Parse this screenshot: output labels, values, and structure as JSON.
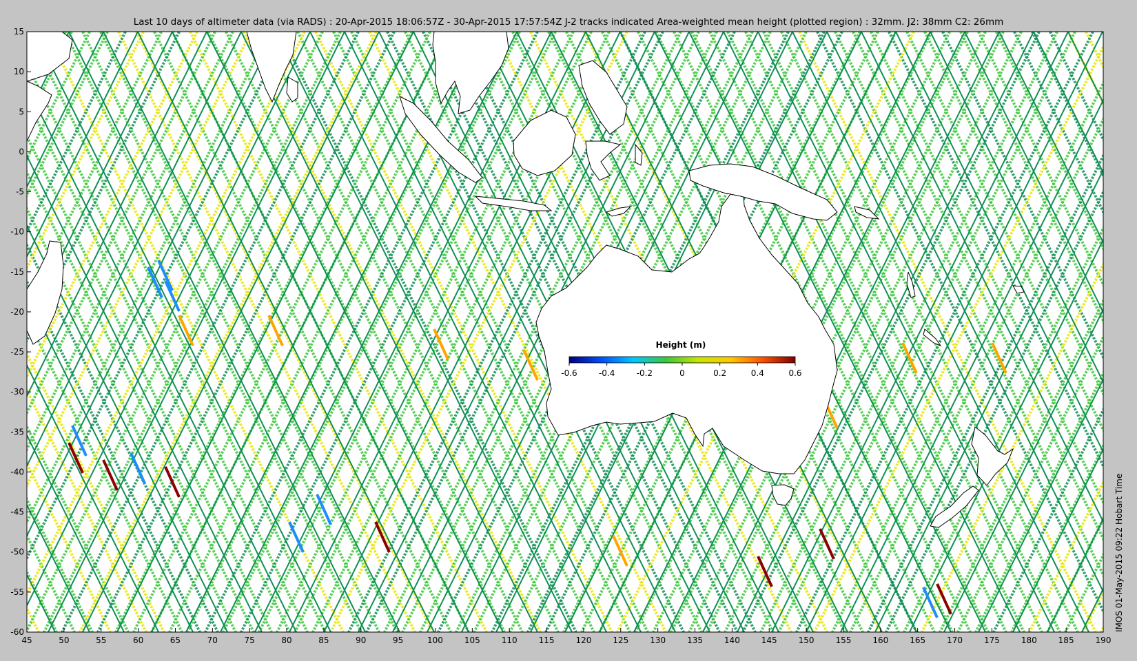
{
  "title": "Last 10 days of altimeter data (via RADS) : 20-Apr-2015 18:06:57Z - 30-Apr-2015 17:57:54Z  J-2 tracks indicated  Area-weighted mean height (plotted region) : 32mm.  J2: 38mm  C2: 26mm",
  "footer_label": "IMOS 01-May-2015 09:22 Hobart Time",
  "colorbar": {
    "title": "Height (m)",
    "range": [
      -0.6,
      0.6
    ],
    "ticks": [
      "-0.6",
      "-0.4",
      "-0.2",
      "0",
      "0.2",
      "0.4",
      "0.6"
    ],
    "colors": [
      "#00007f",
      "#0050ff",
      "#00c8ff",
      "#3cc83c",
      "#c8e600",
      "#ffc800",
      "#ff5000",
      "#7f0000"
    ]
  },
  "map": {
    "lon_range": [
      45,
      190
    ],
    "lat_range": [
      -60,
      15
    ],
    "x_ticks": [
      "45",
      "50",
      "55",
      "60",
      "65",
      "70",
      "75",
      "80",
      "85",
      "90",
      "95",
      "100",
      "105",
      "110",
      "115",
      "120",
      "125",
      "130",
      "135",
      "140",
      "145",
      "150",
      "155",
      "160",
      "165",
      "170",
      "175",
      "180",
      "185",
      "190"
    ],
    "y_ticks": [
      "15",
      "10",
      "5",
      "0",
      "-5",
      "-10",
      "-15",
      "-20",
      "-25",
      "-30",
      "-35",
      "-40",
      "-45",
      "-50",
      "-55",
      "-60"
    ],
    "track_colors": {
      "green": "#3cc83c",
      "dark_green": "#0f8f55",
      "yellow": "#e6e600",
      "orange": "#ffa500",
      "blue": "#1e8cff",
      "dark_red": "#8b0000"
    }
  }
}
